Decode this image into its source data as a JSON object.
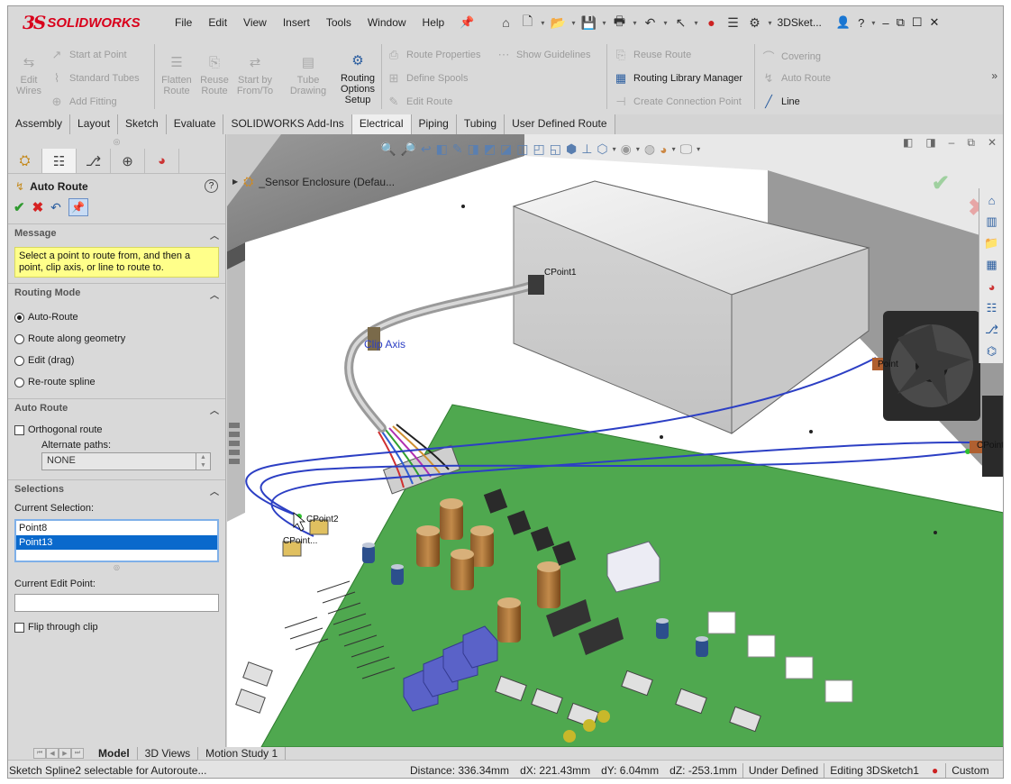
{
  "app": {
    "logo_mark": "3S",
    "logo_text": "SOLIDWORKS",
    "doc_title": "3DSket..."
  },
  "menu": [
    "File",
    "Edit",
    "View",
    "Insert",
    "Tools",
    "Window",
    "Help"
  ],
  "ribbon": {
    "edit_wires": "Edit Wires",
    "start_at_point": "Start at Point",
    "standard_tubes": "Standard Tubes",
    "add_fitting": "Add Fitting",
    "flatten_route": "Flatten Route",
    "reuse_route_small": "Reuse Route",
    "start_by_from_to": "Start by From/To",
    "tube_drawing": "Tube Drawing",
    "routing_options_setup": "Routing Options Setup",
    "route_properties": "Route Properties",
    "define_spools": "Define Spools",
    "edit_route": "Edit Route",
    "show_guidelines": "Show Guidelines",
    "reuse_route": "Reuse Route",
    "routing_library_manager": "Routing Library Manager",
    "create_connection_point": "Create Connection Point",
    "covering": "Covering",
    "auto_route": "Auto Route",
    "line": "Line"
  },
  "tabs": [
    "Assembly",
    "Layout",
    "Sketch",
    "Evaluate",
    "SOLIDWORKS Add-Ins",
    "Electrical",
    "Piping",
    "Tubing",
    "User Defined Route"
  ],
  "active_tab": "Electrical",
  "property_manager": {
    "title": "Auto Route",
    "message_header": "Message",
    "message": "Select a point to route from, and then a point, clip axis, or line to route to.",
    "routing_mode_header": "Routing Mode",
    "modes": [
      "Auto-Route",
      "Route along geometry",
      "Edit (drag)",
      "Re-route spline"
    ],
    "selected_mode": "Auto-Route",
    "auto_route_header": "Auto Route",
    "orthogonal_route": "Orthogonal route",
    "alternate_paths_label": "Alternate paths:",
    "alternate_paths_value": "NONE",
    "selections_header": "Selections",
    "current_selection_label": "Current Selection:",
    "selection_items": [
      "Point8",
      "Point13"
    ],
    "selected_item": "Point13",
    "current_edit_point_label": "Current Edit Point:",
    "current_edit_point_value": "",
    "flip_through_clip": "Flip through clip"
  },
  "graphics": {
    "tree_root": "_Sensor Enclosure  (Defau...",
    "labels": {
      "cpoint1": "CPoint1",
      "cpoint2": "CPoint2",
      "cpoint_b": "CPoint...",
      "clip_axis": "Clip Axis",
      "point_r1": "Point",
      "point_r2": "CPoint"
    }
  },
  "bottom_tabs": [
    "Model",
    "3D Views",
    "Motion Study 1"
  ],
  "status": {
    "message": "Sketch Spline2 selectable for Autoroute...",
    "distance": "Distance: 336.34mm",
    "dx": "dX: 221.43mm",
    "dy": "dY: 6.04mm",
    "dz": "dZ: -253.1mm",
    "state": "Under Defined",
    "editing": "Editing 3DSketch1",
    "custom": "Custom"
  },
  "colors": {
    "brand": "#d9001b",
    "board": "#4fa84f",
    "wire": "#2c3fc4",
    "selection": "#0a69cc",
    "message_bg": "#ffff8a"
  }
}
